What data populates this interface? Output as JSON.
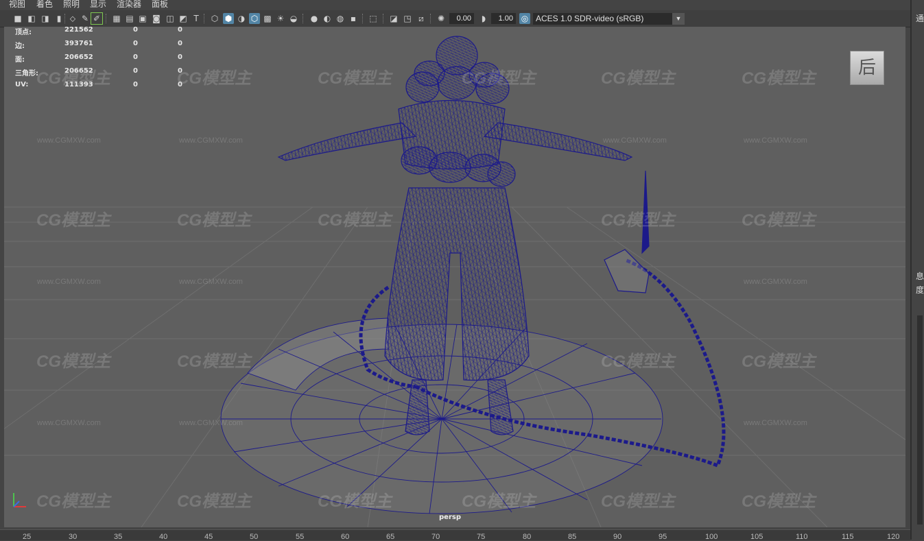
{
  "menu": {
    "items": [
      "视图",
      "着色",
      "照明",
      "显示",
      "渲染器",
      "面板"
    ]
  },
  "toolbar": {
    "exposure_value": "0.00",
    "gamma_value": "1.00",
    "color_space": "ACES 1.0 SDR-video (sRGB)"
  },
  "hud": {
    "rows": [
      {
        "label": "顶点:",
        "a": "221562",
        "b": "0",
        "c": "0"
      },
      {
        "label": "边:",
        "a": "393761",
        "b": "0",
        "c": "0"
      },
      {
        "label": "面:",
        "a": "206652",
        "b": "0",
        "c": "0"
      },
      {
        "label": "三角形:",
        "a": "206652",
        "b": "0",
        "c": "0"
      },
      {
        "label": "UV:",
        "a": "111393",
        "b": "0",
        "c": "0"
      }
    ]
  },
  "viewcube": {
    "face_label": "后"
  },
  "viewport": {
    "camera_name": "persp"
  },
  "watermark": {
    "logo": "CG模型主",
    "url": "www.CGMXW.com"
  },
  "right_panel": {
    "chars": [
      "通",
      "息",
      "度"
    ]
  },
  "time_slider": {
    "ticks": [
      "25",
      "30",
      "35",
      "40",
      "45",
      "50",
      "55",
      "60",
      "65",
      "70",
      "75",
      "80",
      "85",
      "90",
      "95",
      "100",
      "105",
      "110",
      "115",
      "120"
    ]
  },
  "colors": {
    "viewport_bg": "#5f5f5f",
    "wireframe": "#1c1a8a",
    "grid": "#6e6e6e",
    "active_icon": "#5285a6"
  }
}
